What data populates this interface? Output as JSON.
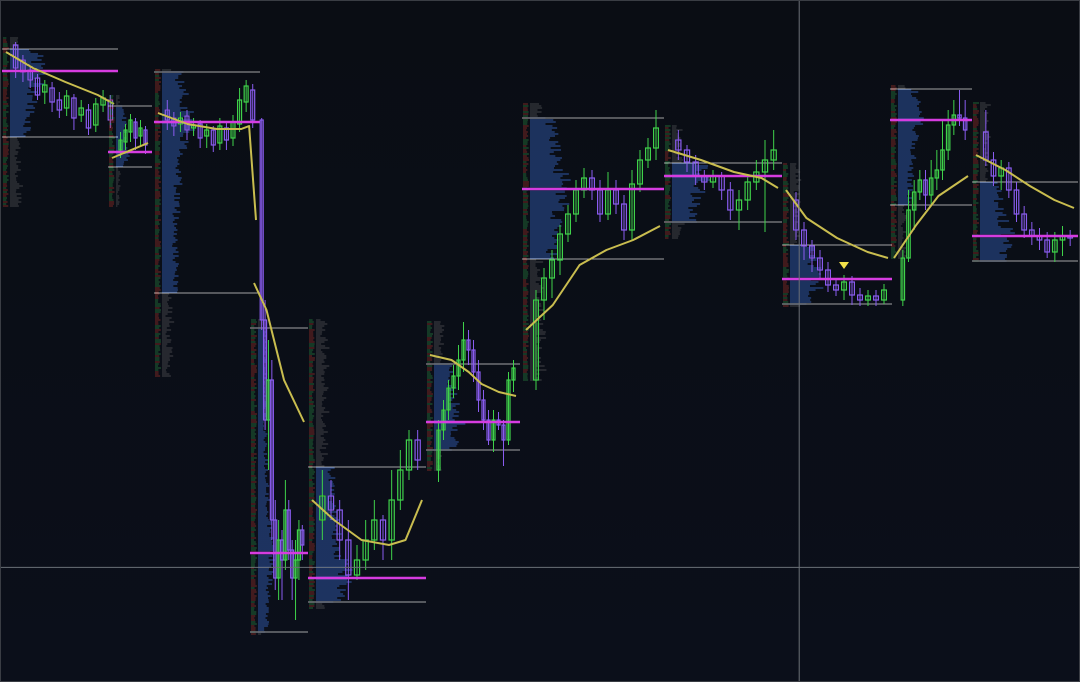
{
  "colors": {
    "background_top": "#0a0d14",
    "background_bottom": "#0b0f1a",
    "bull_candle": "#3fd24a",
    "bear_candle": "#8a5cf0",
    "doji": "#c7c7c7",
    "vwap_line": "#c9bd4f",
    "poc_line": "#d63ce0",
    "value_area_line": "#c8c8c8",
    "profile_blue": "#3b6fd6",
    "profile_gray": "#777777",
    "crosshair": "#6b7077",
    "marker": "#f1e04a"
  },
  "chart_data": {
    "type": "candlestick",
    "title": "",
    "xlabel": "",
    "ylabel": "",
    "crosshair": {
      "x_fraction": 0.74,
      "y_fraction": 0.832
    },
    "sessions": [
      {
        "vah": 49,
        "poc": 71,
        "val": 137,
        "profile_high": 38,
        "profile_low": 206,
        "candles": [
          [
            45,
            68,
            42,
            78
          ],
          [
            60,
            72,
            55,
            82
          ],
          [
            70,
            80,
            66,
            88
          ],
          [
            78,
            95,
            74,
            100
          ],
          [
            92,
            85,
            80,
            104
          ],
          [
            88,
            102,
            82,
            112
          ],
          [
            100,
            110,
            92,
            118
          ],
          [
            108,
            96,
            90,
            116
          ],
          [
            98,
            118,
            94,
            130
          ],
          [
            115,
            108,
            100,
            122
          ],
          [
            110,
            128,
            104,
            135
          ],
          [
            125,
            104,
            98,
            132
          ],
          [
            105,
            98,
            90,
            112
          ],
          [
            100,
            120,
            95,
            128
          ]
        ],
        "vwap": [
          [
            0,
            52
          ],
          [
            0.25,
            68
          ],
          [
            0.55,
            82
          ],
          [
            0.85,
            95
          ],
          [
            1,
            104
          ]
        ]
      },
      {
        "vah": 106,
        "poc": 152,
        "val": 167,
        "profile_high": 96,
        "profile_low": 206,
        "candles": [
          [
            150,
            140,
            132,
            158
          ],
          [
            142,
            130,
            124,
            150
          ],
          [
            132,
            120,
            114,
            142
          ],
          [
            122,
            138,
            118,
            150
          ],
          [
            136,
            128,
            120,
            146
          ],
          [
            130,
            145,
            126,
            154
          ]
        ],
        "vwap": [
          [
            0,
            158
          ],
          [
            1,
            143
          ]
        ]
      },
      {
        "vah": 72,
        "poc": 122,
        "val": 293,
        "profile_high": 70,
        "profile_low": 376,
        "candles": [
          [
            110,
            120,
            100,
            130
          ],
          [
            118,
            126,
            112,
            136
          ],
          [
            124,
            118,
            112,
            132
          ],
          [
            116,
            130,
            110,
            140
          ],
          [
            128,
            125,
            118,
            136
          ],
          [
            124,
            138,
            120,
            148
          ],
          [
            136,
            130,
            124,
            148
          ],
          [
            130,
            145,
            126,
            152
          ],
          [
            143,
            126,
            118,
            150
          ],
          [
            128,
            140,
            122,
            150
          ],
          [
            138,
            122,
            115,
            146
          ],
          [
            124,
            100,
            88,
            132
          ],
          [
            102,
            86,
            80,
            112
          ],
          [
            90,
            120,
            84,
            128
          ]
        ],
        "vwap": [
          [
            0,
            113
          ],
          [
            0.3,
            124
          ],
          [
            0.6,
            129
          ],
          [
            0.85,
            129
          ],
          [
            0.93,
            126
          ],
          [
            1,
            220
          ]
        ]
      },
      {
        "vah": 328,
        "poc": 553,
        "val": 632,
        "profile_high": 320,
        "profile_low": 634,
        "candles": [
          [
            120,
            320,
            118,
            330
          ],
          [
            320,
            420,
            300,
            430
          ],
          [
            420,
            380,
            340,
            470
          ],
          [
            380,
            520,
            360,
            540
          ],
          [
            520,
            578,
            500,
            590
          ],
          [
            578,
            540,
            520,
            600
          ],
          [
            540,
            560,
            530,
            600
          ],
          [
            560,
            510,
            480,
            570
          ],
          [
            510,
            550,
            500,
            560
          ],
          [
            550,
            578,
            540,
            600
          ],
          [
            578,
            560,
            540,
            620
          ],
          [
            560,
            530,
            520,
            580
          ],
          [
            530,
            545,
            525,
            560
          ]
        ],
        "vwap": [
          [
            0,
            283
          ],
          [
            0.25,
            310
          ],
          [
            0.6,
            380
          ],
          [
            1,
            422
          ]
        ]
      },
      {
        "vah": 467,
        "poc": 578,
        "val": 602,
        "profile_high": 320,
        "profile_low": 608,
        "candles": [
          [
            520,
            496,
            470,
            540
          ],
          [
            496,
            510,
            480,
            520
          ],
          [
            510,
            540,
            500,
            560
          ],
          [
            540,
            575,
            520,
            600
          ],
          [
            575,
            560,
            545,
            580
          ],
          [
            560,
            540,
            520,
            570
          ],
          [
            540,
            520,
            500,
            550
          ],
          [
            520,
            540,
            515,
            560
          ],
          [
            540,
            500,
            470,
            560
          ],
          [
            500,
            470,
            450,
            510
          ],
          [
            470,
            440,
            430,
            480
          ],
          [
            440,
            460,
            430,
            470
          ]
        ],
        "vwap": [
          [
            0,
            500
          ],
          [
            0.2,
            520
          ],
          [
            0.45,
            540
          ],
          [
            0.7,
            545
          ],
          [
            0.85,
            540
          ],
          [
            1,
            500
          ]
        ]
      },
      {
        "vah": 364,
        "poc": 422,
        "val": 450,
        "profile_high": 322,
        "profile_low": 470,
        "candles": [
          [
            470,
            430,
            420,
            482
          ],
          [
            430,
            410,
            400,
            440
          ],
          [
            410,
            388,
            380,
            420
          ],
          [
            388,
            376,
            365,
            398
          ],
          [
            376,
            360,
            345,
            390
          ],
          [
            360,
            340,
            322,
            372
          ],
          [
            340,
            350,
            330,
            365
          ],
          [
            350,
            372,
            340,
            382
          ],
          [
            372,
            400,
            360,
            412
          ],
          [
            400,
            420,
            390,
            430
          ],
          [
            420,
            440,
            410,
            445
          ],
          [
            440,
            420,
            410,
            452
          ],
          [
            420,
            425,
            412,
            430
          ],
          [
            425,
            440,
            420,
            466
          ],
          [
            440,
            380,
            372,
            445
          ],
          [
            380,
            368,
            360,
            392
          ]
        ],
        "vwap": [
          [
            0,
            355
          ],
          [
            0.25,
            360
          ],
          [
            0.45,
            372
          ],
          [
            0.6,
            384
          ],
          [
            0.8,
            392
          ],
          [
            1,
            396
          ]
        ]
      },
      {
        "vah": 118,
        "poc": 189,
        "val": 259,
        "profile_high": 104,
        "profile_low": 380,
        "candles": [
          [
            380,
            300,
            290,
            390
          ],
          [
            300,
            278,
            268,
            320
          ],
          [
            278,
            260,
            250,
            298
          ],
          [
            260,
            234,
            225,
            275
          ],
          [
            234,
            214,
            205,
            242
          ],
          [
            214,
            190,
            180,
            222
          ],
          [
            190,
            178,
            168,
            198
          ],
          [
            178,
            190,
            170,
            200
          ],
          [
            190,
            214,
            180,
            222
          ],
          [
            214,
            190,
            172,
            220
          ],
          [
            190,
            204,
            180,
            214
          ],
          [
            204,
            230,
            195,
            240
          ],
          [
            230,
            184,
            170,
            240
          ],
          [
            184,
            160,
            150,
            192
          ],
          [
            160,
            148,
            138,
            168
          ],
          [
            148,
            128,
            110,
            160
          ]
        ],
        "vwap": [
          [
            0,
            330
          ],
          [
            0.2,
            305
          ],
          [
            0.4,
            265
          ],
          [
            0.6,
            250
          ],
          [
            0.8,
            240
          ],
          [
            1,
            226
          ]
        ]
      },
      {
        "vah": 163,
        "poc": 176,
        "val": 222,
        "profile_high": 126,
        "profile_low": 238,
        "candles": [
          [
            140,
            150,
            130,
            160
          ],
          [
            150,
            162,
            145,
            172
          ],
          [
            162,
            176,
            155,
            185
          ],
          [
            176,
            182,
            170,
            190
          ],
          [
            182,
            176,
            170,
            188
          ],
          [
            176,
            190,
            172,
            200
          ],
          [
            190,
            210,
            182,
            220
          ],
          [
            210,
            200,
            190,
            230
          ],
          [
            200,
            182,
            174,
            210
          ],
          [
            182,
            172,
            160,
            190
          ],
          [
            172,
            160,
            140,
            232
          ],
          [
            160,
            150,
            130,
            170
          ]
        ],
        "vwap": [
          [
            0,
            150
          ],
          [
            0.3,
            160
          ],
          [
            0.6,
            172
          ],
          [
            0.85,
            178
          ],
          [
            1,
            188
          ]
        ]
      },
      {
        "vah": 245,
        "poc": 279,
        "val": 304,
        "profile_high": 164,
        "profile_low": 306,
        "candles": [
          [
            200,
            230,
            192,
            240
          ],
          [
            230,
            246,
            222,
            260
          ],
          [
            246,
            258,
            240,
            272
          ],
          [
            258,
            270,
            250,
            280
          ],
          [
            270,
            285,
            262,
            292
          ],
          [
            285,
            290,
            278,
            296
          ],
          [
            290,
            282,
            275,
            300
          ],
          [
            282,
            295,
            276,
            305
          ],
          [
            295,
            300,
            288,
            306
          ],
          [
            300,
            296,
            290,
            306
          ],
          [
            296,
            300,
            290,
            306
          ],
          [
            300,
            290,
            284,
            304
          ]
        ],
        "vwap": [
          [
            0,
            190
          ],
          [
            0.2,
            218
          ],
          [
            0.5,
            238
          ],
          [
            0.8,
            252
          ],
          [
            1,
            258
          ]
        ]
      },
      {
        "vah": 89,
        "poc": 120,
        "val": 205,
        "profile_high": 86,
        "profile_low": 258,
        "candles": [
          [
            300,
            258,
            250,
            306
          ],
          [
            258,
            210,
            190,
            262
          ],
          [
            210,
            192,
            180,
            230
          ],
          [
            192,
            180,
            170,
            200
          ],
          [
            180,
            195,
            170,
            210
          ],
          [
            195,
            178,
            160,
            205
          ],
          [
            178,
            170,
            150,
            190
          ],
          [
            170,
            150,
            120,
            180
          ],
          [
            150,
            125,
            110,
            160
          ],
          [
            125,
            115,
            100,
            135
          ],
          [
            115,
            118,
            90,
            126
          ],
          [
            118,
            130,
            100,
            140
          ]
        ],
        "vwap": [
          [
            0,
            258
          ],
          [
            0.3,
            225
          ],
          [
            0.6,
            196
          ],
          [
            1,
            176
          ]
        ]
      },
      {
        "vah": 182,
        "poc": 236,
        "val": 261,
        "profile_high": 103,
        "profile_low": 262,
        "candles": [
          [
            132,
            160,
            110,
            166
          ],
          [
            160,
            176,
            152,
            186
          ],
          [
            176,
            168,
            160,
            190
          ],
          [
            168,
            190,
            162,
            198
          ],
          [
            190,
            214,
            182,
            222
          ],
          [
            214,
            230,
            206,
            238
          ],
          [
            230,
            236,
            222,
            245
          ],
          [
            236,
            240,
            228,
            250
          ],
          [
            240,
            252,
            232,
            258
          ],
          [
            252,
            240,
            232,
            262
          ],
          [
            240,
            236,
            226,
            256
          ],
          [
            236,
            238,
            230,
            246
          ]
        ],
        "vwap": [
          [
            0,
            155
          ],
          [
            0.3,
            170
          ],
          [
            0.55,
            186
          ],
          [
            0.8,
            200
          ],
          [
            1,
            208
          ]
        ]
      }
    ],
    "markers": [
      {
        "type": "triangle-down",
        "session": 8,
        "candle": 6
      }
    ]
  }
}
